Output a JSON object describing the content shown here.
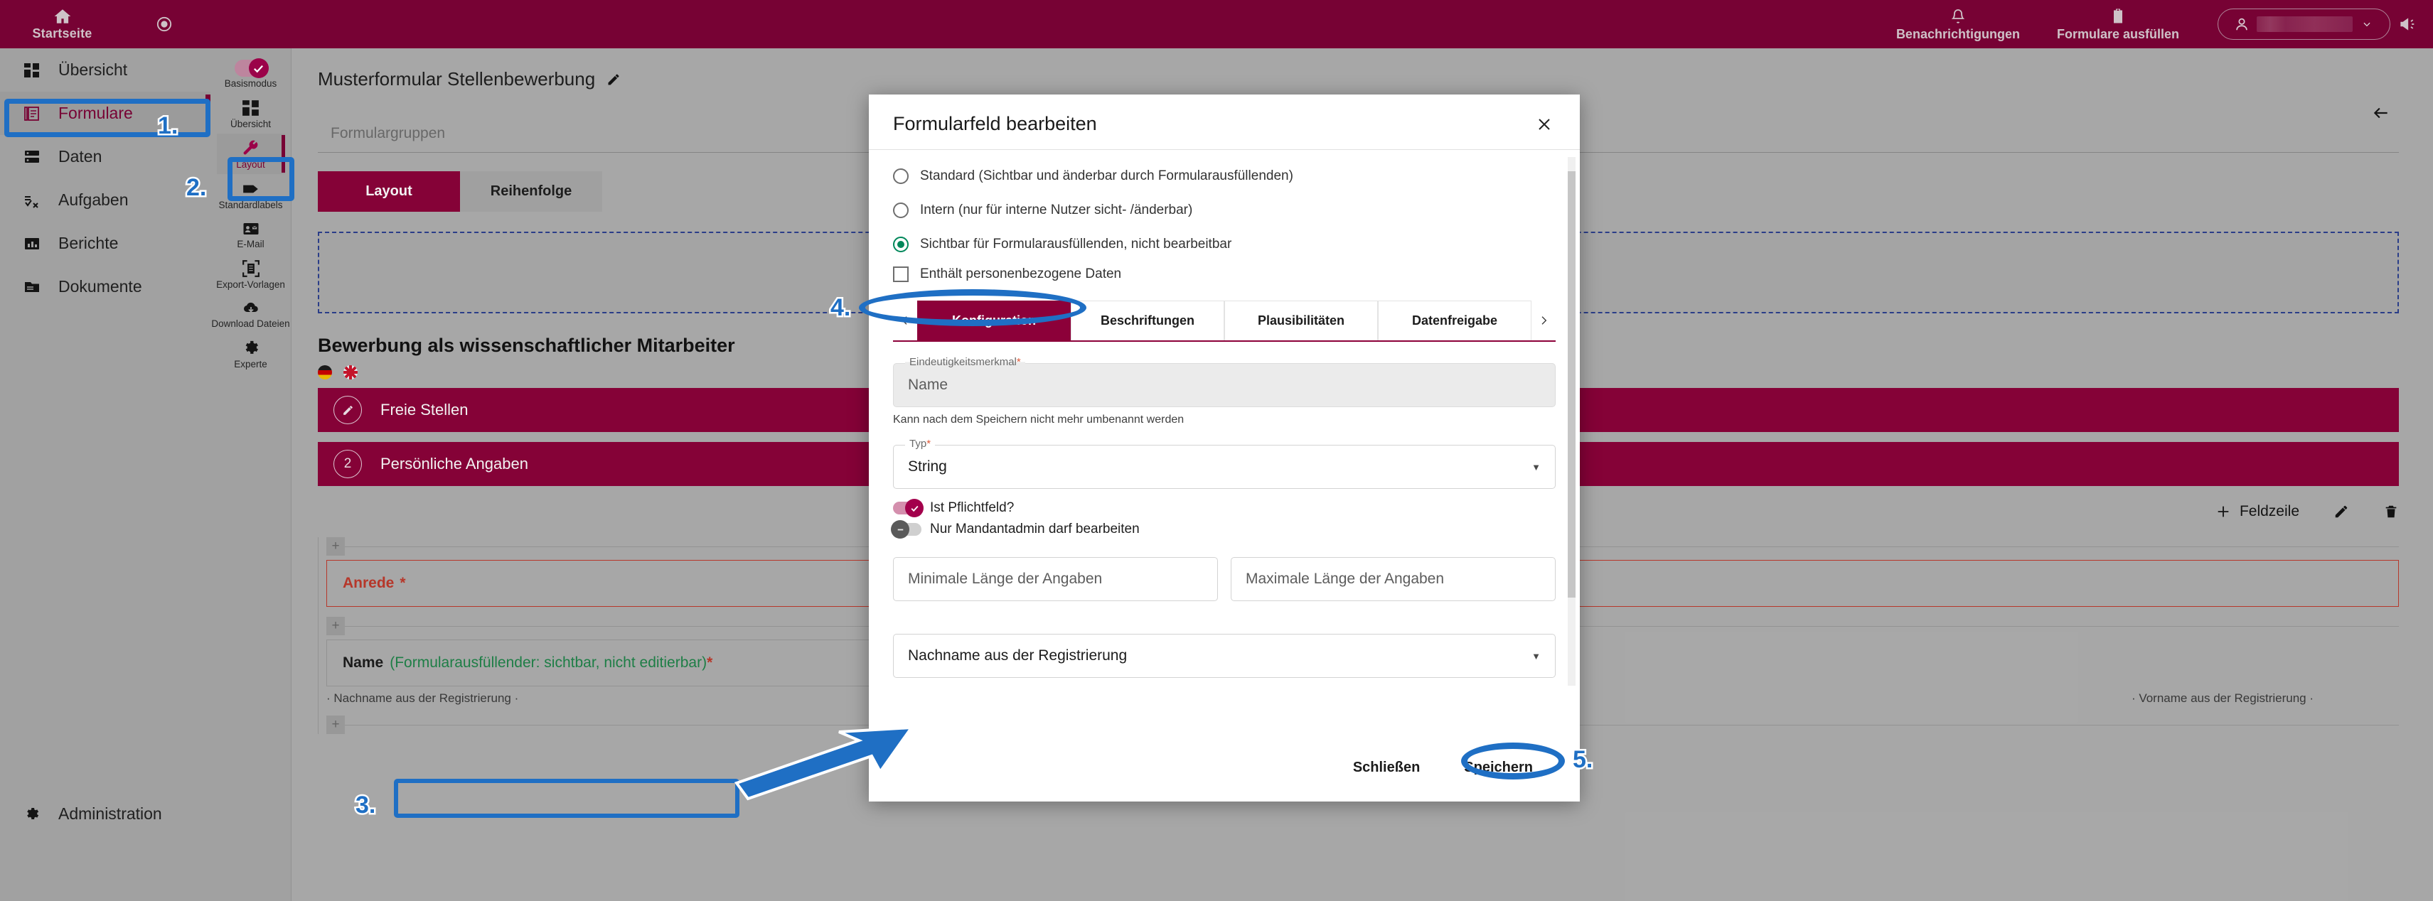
{
  "topbar": {
    "home_label": "Startseite",
    "home_icon": "home-icon",
    "record_icon": "record-circle-icon",
    "notifications_label": "Benachrichtigungen",
    "notifications_icon": "bell-icon",
    "fill_forms_label": "Formulare ausfüllen",
    "fill_forms_icon": "clipboard-icon",
    "user_icon": "person-icon",
    "user_caret_icon": "chevron-down-icon",
    "megaphone_icon": "megaphone-icon",
    "brand_color": "#7d0036"
  },
  "sidebar": {
    "items": [
      {
        "label": "Übersicht",
        "icon": "dashboard-grid-icon",
        "active": false
      },
      {
        "label": "Formulare",
        "icon": "forms-stack-icon",
        "active": true
      },
      {
        "label": "Daten",
        "icon": "database-icon",
        "active": false
      },
      {
        "label": "Aufgaben",
        "icon": "tasks-checklist-icon",
        "active": false
      },
      {
        "label": "Berichte",
        "icon": "bar-chart-icon",
        "active": false
      },
      {
        "label": "Dokumente",
        "icon": "folder-icon",
        "active": false
      }
    ],
    "admin_label": "Administration",
    "admin_icon": "gear-icon"
  },
  "iconrail": {
    "basismodus_label": "Basismodus",
    "basismodus_on": true,
    "items": [
      {
        "label": "Übersicht",
        "icon": "dashboard-grid-icon",
        "active": false
      },
      {
        "label": "Layout",
        "icon": "wrench-icon",
        "active": true
      },
      {
        "label": "Standardlabels",
        "icon": "tag-icon",
        "active": false
      },
      {
        "label": "E-Mail",
        "icon": "contact-card-icon",
        "active": false
      },
      {
        "label": "Export-Vorlagen",
        "icon": "export-frame-icon",
        "active": false
      },
      {
        "label": "Download Dateien",
        "icon": "cloud-download-icon",
        "active": false
      },
      {
        "label": "Experte",
        "icon": "gear-icon",
        "active": false
      }
    ]
  },
  "page": {
    "title": "Musterformular Stellenbewerbung",
    "title_edit_icon": "pencil-icon",
    "back_icon": "arrow-left-icon",
    "formgroups_placeholder": "Formulargruppen",
    "tabs": [
      {
        "label": "Layout",
        "active": true
      },
      {
        "label": "Reihenfolge",
        "active": false
      }
    ],
    "section_heading": "Bewerbung als wissenschaftlicher Mitarbeiter",
    "flags": [
      "flag-de-icon",
      "flag-uk-icon"
    ],
    "sections": [
      {
        "badge": "pencil",
        "label": "Freie Stellen"
      },
      {
        "badge": "2",
        "label": "Persönliche Angaben"
      }
    ],
    "rowtools": {
      "add_label": "Feldzeile",
      "add_icon": "plus-icon",
      "edit_icon": "pencil-icon",
      "delete_icon": "trash-icon"
    },
    "fields": [
      {
        "label": "Anrede",
        "required_mark": "*",
        "style": "required-red",
        "helper": ""
      },
      {
        "label": "Name",
        "annotation": "(Formularausfüllender: sichtbar, nicht editierbar)",
        "required_mark": "*",
        "style": "selected",
        "helper": "· Nachname aus der Registrierung ·"
      }
    ],
    "right_helper": "· Vorname aus der Registrierung ·"
  },
  "modal": {
    "title": "Formularfeld bearbeiten",
    "close_icon": "close-x-icon",
    "visibility_options": [
      {
        "label": "Standard (Sichtbar und änderbar durch Formularausfüllenden)",
        "selected": false
      },
      {
        "label": "Intern (nur für interne Nutzer sicht- /änderbar)",
        "selected": false
      },
      {
        "label": "Sichtbar für Formularausfüllenden, nicht bearbeitbar",
        "selected": true
      }
    ],
    "personal_data": {
      "label": "Enthält personenbezogene Daten",
      "checked": false
    },
    "tabs_prev_icon": "chevron-left-icon",
    "tabs_next_icon": "chevron-right-icon",
    "tabs": [
      {
        "label": "Konfiguration",
        "active": true
      },
      {
        "label": "Beschriftungen",
        "active": false
      },
      {
        "label": "Plausibilitäten",
        "active": false
      },
      {
        "label": "Datenfreigabe",
        "active": false
      }
    ],
    "unique_field": {
      "legend": "Eindeutigkeitsmerkmal",
      "required_mark": "*",
      "placeholder": "Name",
      "hint": "Kann nach dem Speichern nicht mehr umbenannt werden"
    },
    "type_field": {
      "legend": "Typ",
      "required_mark": "*",
      "value": "String",
      "caret_icon": "chevron-down-icon"
    },
    "switches": [
      {
        "label": "Ist Pflichtfeld?",
        "on": true
      },
      {
        "label": "Nur Mandantadmin darf bearbeiten",
        "on": false
      }
    ],
    "length_fields": [
      {
        "placeholder": "Minimale Länge der Angaben"
      },
      {
        "placeholder": "Maximale Länge der Angaben"
      }
    ],
    "bottom_select": {
      "value": "Nachname aus der Registrierung",
      "caret_icon": "chevron-down-icon"
    },
    "footer": {
      "close_label": "Schließen",
      "save_label": "Speichern"
    }
  },
  "annotations": {
    "markers": [
      "1.",
      "2.",
      "3.",
      "4.",
      "5."
    ],
    "color": "#1f6fc4"
  }
}
